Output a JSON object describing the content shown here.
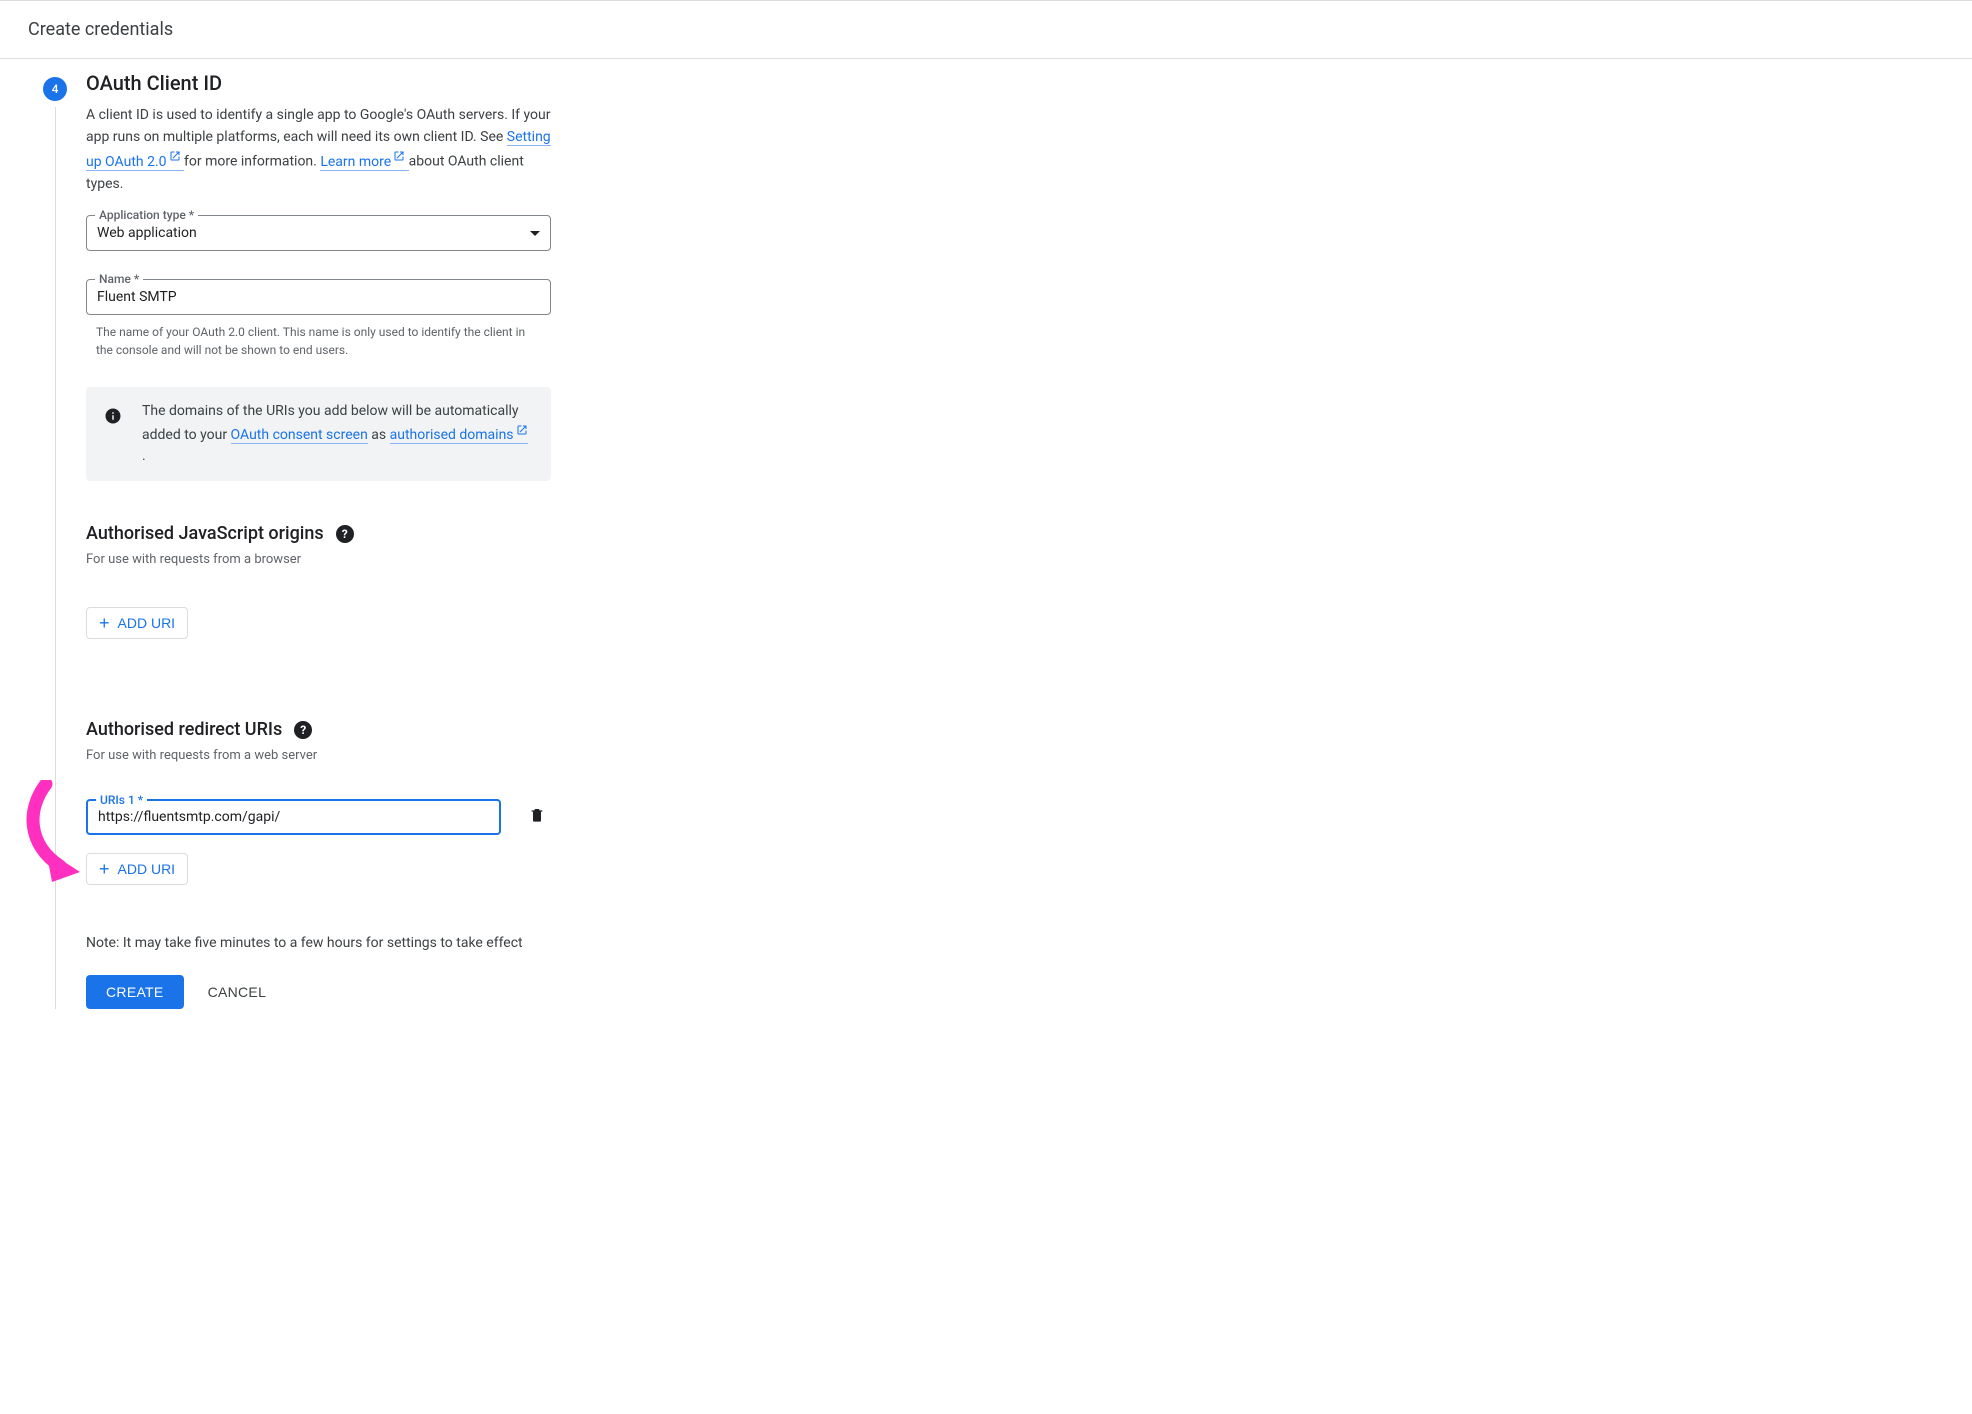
{
  "page": {
    "title": "Create credentials"
  },
  "step": {
    "number": "4",
    "title": "OAuth Client ID",
    "desc_parts": {
      "p1": "A client ID is used to identify a single app to Google's OAuth servers. If your app runs on multiple platforms, each will need its own client ID. See ",
      "link1": "Setting up OAuth 2.0",
      "p2": " for more information. ",
      "link2": "Learn more",
      "p3": " about OAuth client types."
    }
  },
  "fields": {
    "app_type": {
      "label": "Application type *",
      "value": "Web application"
    },
    "name": {
      "label": "Name *",
      "value": "Fluent SMTP",
      "helper": "The name of your OAuth 2.0 client. This name is only used to identify the client in the console and will not be shown to end users."
    }
  },
  "info_banner": {
    "p1": "The domains of the URIs you add below will be automatically added to your ",
    "link1": "OAuth consent screen",
    "p2": " as ",
    "link2": "authorised domains",
    "p3": "."
  },
  "js_origins": {
    "heading": "Authorised JavaScript origins",
    "desc": "For use with requests from a browser",
    "add_label": "ADD URI"
  },
  "redirect_uris": {
    "heading": "Authorised redirect URIs",
    "desc": "For use with requests from a web server",
    "entries": [
      {
        "label": "URIs 1 *",
        "value": "https://fluentsmtp.com/gapi/"
      }
    ],
    "add_label": "ADD URI"
  },
  "note": "Note: It may take five minutes to a few hours for settings to take effect",
  "actions": {
    "create": "CREATE",
    "cancel": "CANCEL"
  }
}
